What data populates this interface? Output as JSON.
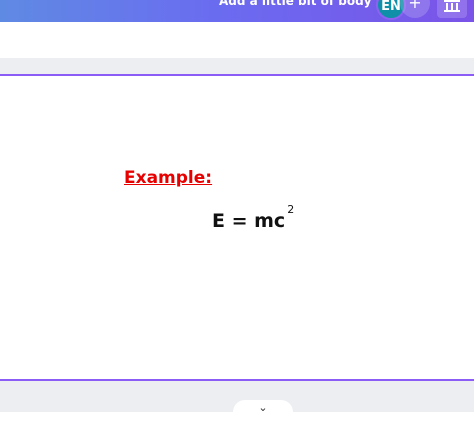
{
  "toolbar": {
    "body_text_button": "Add a little bit of body text",
    "language_badge": "EN",
    "add_button": "+",
    "accent_gradient": [
      "#5f8ae3",
      "#7a53e8"
    ]
  },
  "canvas": {
    "heading": "Example:",
    "formula_base": "E = mc",
    "formula_exponent": "2",
    "heading_color": "#e60000",
    "page_border_color": "#8b5cf6"
  },
  "footer": {
    "collapse_icon": "chevron-down-icon",
    "collapse_glyph": "⌄"
  }
}
